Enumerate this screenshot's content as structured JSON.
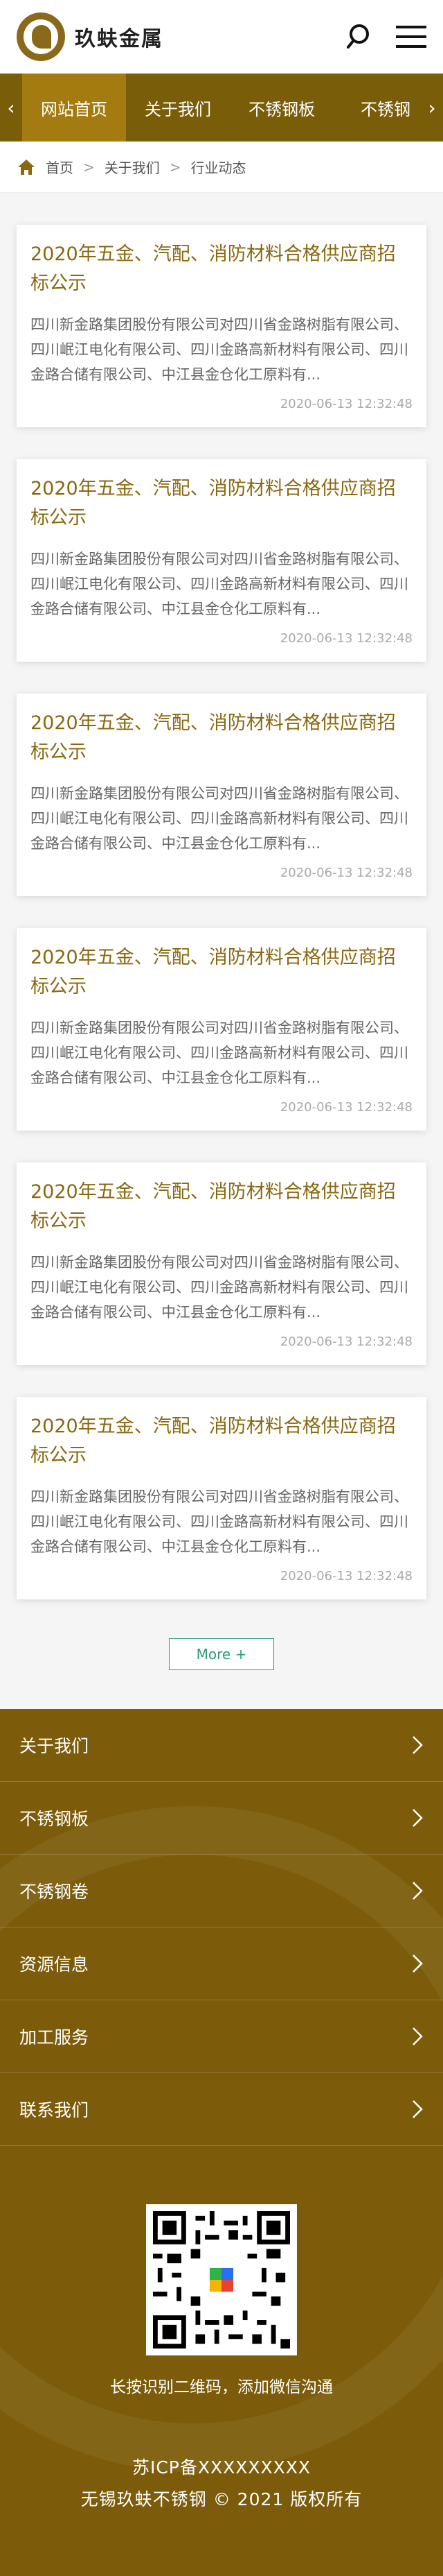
{
  "header": {
    "logo_text": "玖蚨金属"
  },
  "nav": {
    "items": [
      {
        "label": "网站首页",
        "active": true
      },
      {
        "label": "关于我们",
        "active": false
      },
      {
        "label": "不锈钢板",
        "active": false
      },
      {
        "label": "不锈钢",
        "active": false
      }
    ]
  },
  "breadcrumb": {
    "home": "首页",
    "level1": "关于我们",
    "level2": "行业动态"
  },
  "articles": [
    {
      "title": "2020年五金、汽配、消防材料合格供应商招标公示",
      "summary": "四川新金路集团股份有限公司对四川省金路树脂有限公司、四川岷江电化有限公司、四川金路高新材料有限公司、四川金路合储有限公司、中江县金仓化工原料有...",
      "date": "2020-06-13 12:32:48"
    },
    {
      "title": "2020年五金、汽配、消防材料合格供应商招标公示",
      "summary": "四川新金路集团股份有限公司对四川省金路树脂有限公司、四川岷江电化有限公司、四川金路高新材料有限公司、四川金路合储有限公司、中江县金仓化工原料有...",
      "date": "2020-06-13 12:32:48"
    },
    {
      "title": "2020年五金、汽配、消防材料合格供应商招标公示",
      "summary": "四川新金路集团股份有限公司对四川省金路树脂有限公司、四川岷江电化有限公司、四川金路高新材料有限公司、四川金路合储有限公司、中江县金仓化工原料有...",
      "date": "2020-06-13 12:32:48"
    },
    {
      "title": "2020年五金、汽配、消防材料合格供应商招标公示",
      "summary": "四川新金路集团股份有限公司对四川省金路树脂有限公司、四川岷江电化有限公司、四川金路高新材料有限公司、四川金路合储有限公司、中江县金仓化工原料有...",
      "date": "2020-06-13 12:32:48"
    },
    {
      "title": "2020年五金、汽配、消防材料合格供应商招标公示",
      "summary": "四川新金路集团股份有限公司对四川省金路树脂有限公司、四川岷江电化有限公司、四川金路高新材料有限公司、四川金路合储有限公司、中江县金仓化工原料有...",
      "date": "2020-06-13 12:32:48"
    },
    {
      "title": "2020年五金、汽配、消防材料合格供应商招标公示",
      "summary": "四川新金路集团股份有限公司对四川省金路树脂有限公司、四川岷江电化有限公司、四川金路高新材料有限公司、四川金路合储有限公司、中江县金仓化工原料有...",
      "date": "2020-06-13 12:32:48"
    }
  ],
  "more_label": "More +",
  "footer": {
    "links": [
      "关于我们",
      "不锈钢板",
      "不锈钢卷",
      "资源信息",
      "加工服务",
      "联系我们"
    ],
    "qr_caption": "长按识别二维码，添加微信沟通",
    "icp": "苏ICP备XXXXXXXXX",
    "copyright": "无锡玖蚨不锈钢 © 2021 版权所有"
  },
  "colors": {
    "brand": "#7a5d09",
    "active_nav": "#a37b10",
    "title": "#8a6810",
    "more": "#2a9d7a"
  }
}
